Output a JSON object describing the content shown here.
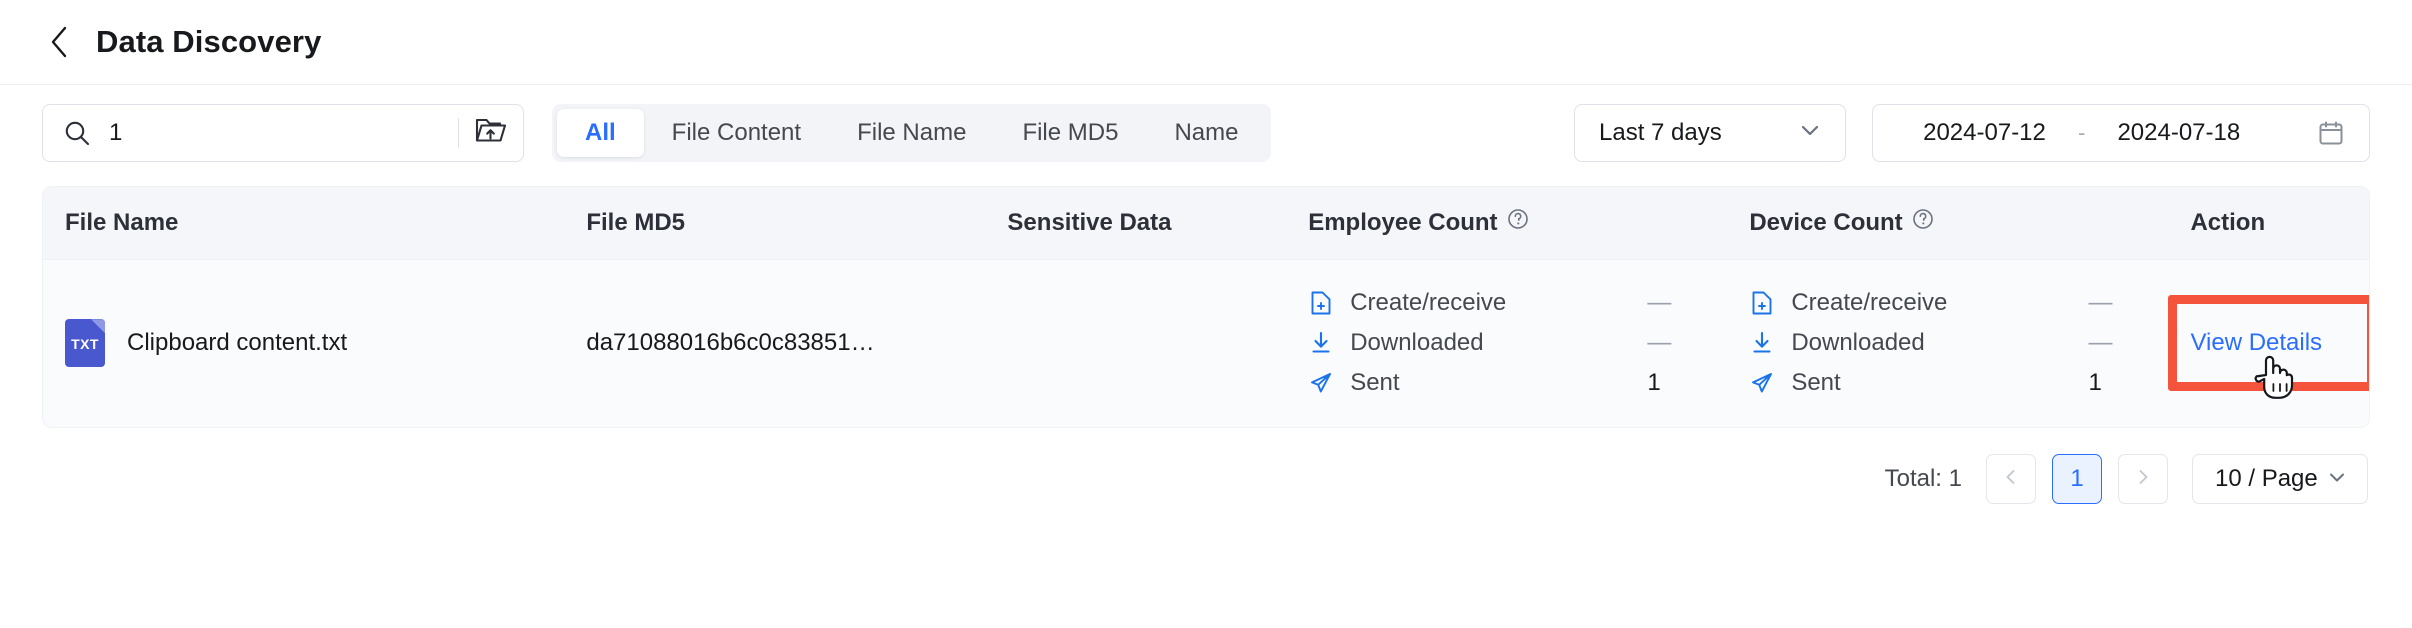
{
  "header": {
    "back_icon": "chevron-left-icon",
    "title": "Data Discovery"
  },
  "toolbar": {
    "search": {
      "icon": "search-icon",
      "value": "1",
      "placeholder": "Search"
    },
    "folder_button_icon": "folder-upload-icon",
    "tabs": [
      {
        "label": "All",
        "active": true
      },
      {
        "label": "File Content",
        "active": false
      },
      {
        "label": "File Name",
        "active": false
      },
      {
        "label": "File MD5",
        "active": false
      },
      {
        "label": "Name",
        "active": false
      }
    ],
    "range_select": {
      "value": "Last 7 days",
      "icon": "chevron-down-icon"
    },
    "date_range": {
      "start": "2024-07-12",
      "separator": "-",
      "end": "2024-07-18",
      "icon": "calendar-icon"
    }
  },
  "table": {
    "columns": [
      {
        "label": "File Name",
        "help": false
      },
      {
        "label": "File MD5",
        "help": false
      },
      {
        "label": "Sensitive Data",
        "help": false
      },
      {
        "label": "Employee Count",
        "help": true
      },
      {
        "label": "Device Count",
        "help": true
      },
      {
        "label": "Action",
        "help": false
      }
    ],
    "help_icon": "question-circle-icon",
    "rows": [
      {
        "file_icon_label": "TXT",
        "file_name": "Clipboard content.txt",
        "file_md5": "da71088016b6c0c83851…",
        "sensitive_data": "",
        "employee_count": [
          {
            "icon": "file-plus-icon",
            "label": "Create/receive",
            "value": "—",
            "is_dash": true
          },
          {
            "icon": "download-icon",
            "label": "Downloaded",
            "value": "—",
            "is_dash": true
          },
          {
            "icon": "send-icon",
            "label": "Sent",
            "value": "1",
            "is_dash": false
          }
        ],
        "device_count": [
          {
            "icon": "file-plus-icon",
            "label": "Create/receive",
            "value": "—",
            "is_dash": true
          },
          {
            "icon": "download-icon",
            "label": "Downloaded",
            "value": "—",
            "is_dash": true
          },
          {
            "icon": "send-icon",
            "label": "Sent",
            "value": "1",
            "is_dash": false
          }
        ],
        "action_label": "View Details"
      }
    ]
  },
  "pagination": {
    "total_text": "Total: 1",
    "prev_icon": "chevron-left-icon",
    "next_icon": "chevron-right-icon",
    "current_page": "1",
    "page_size": "10  / Page",
    "page_size_icon": "chevron-down-icon"
  },
  "annotation": {
    "highlight_color": "#f4543c",
    "cursor_icon": "hand-pointer-cursor"
  },
  "colors": {
    "accent": "#2a6eff",
    "icon_blue": "#1a73e8",
    "file_icon": "#4a58cf",
    "header_bg": "#f5f6f9",
    "row_bg": "#fafbfc"
  }
}
